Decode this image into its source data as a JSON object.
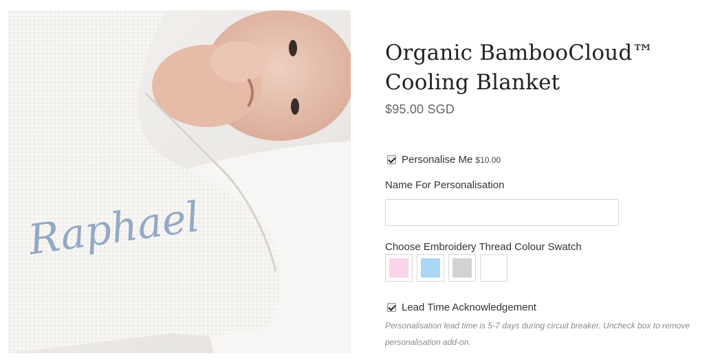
{
  "product": {
    "title_line1": "Organic BambooCloud™",
    "title_line2": "Cooling Blanket",
    "price": "$95.00 SGD",
    "image_embroidery_text": "Raphael"
  },
  "options": {
    "personalise_label": "Personalise Me",
    "personalise_price": "$10.00",
    "personalise_checked": true,
    "name_label": "Name For Personalisation",
    "name_value": "",
    "swatch_label": "Choose Embroidery Thread Colour Swatch",
    "swatches": [
      {
        "color": "#f9d5ec"
      },
      {
        "color": "#acd6f5"
      },
      {
        "color": "#d2d2d2"
      },
      {
        "color": "#ffffff"
      }
    ],
    "lead_time_label": "Lead Time Acknowledgement",
    "lead_time_checked": true,
    "lead_time_note": "Personalisation lead time is 5-7 days during circuit breaker. Uncheck box to remove personalisation add-on."
  }
}
